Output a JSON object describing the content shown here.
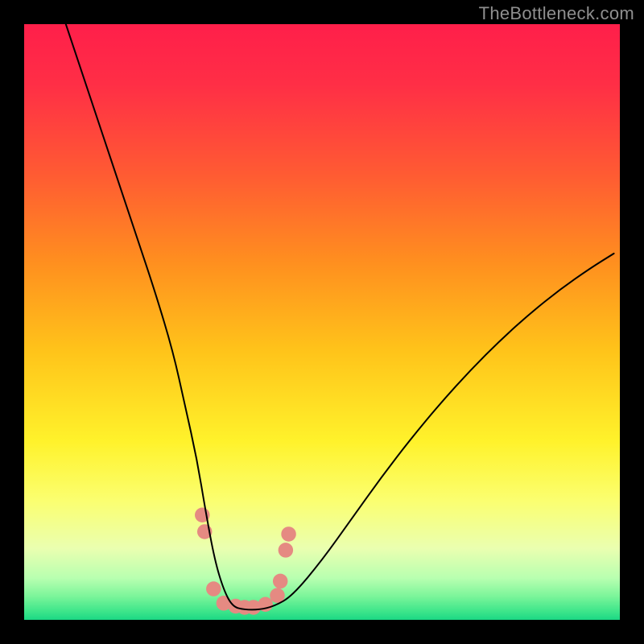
{
  "watermark": {
    "text": "TheBottleneck.com"
  },
  "plot": {
    "background_gradient_stops": [
      {
        "offset": 0.0,
        "color": "#ff1f4a"
      },
      {
        "offset": 0.1,
        "color": "#ff2e46"
      },
      {
        "offset": 0.25,
        "color": "#ff5a33"
      },
      {
        "offset": 0.4,
        "color": "#ff8f1f"
      },
      {
        "offset": 0.55,
        "color": "#ffc41a"
      },
      {
        "offset": 0.7,
        "color": "#fff22b"
      },
      {
        "offset": 0.8,
        "color": "#fbff70"
      },
      {
        "offset": 0.88,
        "color": "#eaffb0"
      },
      {
        "offset": 0.93,
        "color": "#b8ffb0"
      },
      {
        "offset": 0.96,
        "color": "#7cf59a"
      },
      {
        "offset": 0.985,
        "color": "#3fe68b"
      },
      {
        "offset": 1.0,
        "color": "#1bd884"
      }
    ]
  },
  "chart_data": {
    "type": "line",
    "title": "",
    "xlabel": "",
    "ylabel": "",
    "xlim": [
      0,
      100
    ],
    "ylim": [
      0,
      100
    ],
    "legend": false,
    "grid": false,
    "series": [
      {
        "name": "bottleneck-curve",
        "color": "#000000",
        "x": [
          7,
          10,
          13,
          16,
          19,
          22,
          25,
          27,
          29,
          30.5,
          32,
          33.5,
          35,
          37,
          39.5,
          42,
          45,
          50,
          55,
          60,
          65,
          70,
          75,
          80,
          85,
          90,
          95,
          99
        ],
        "y": [
          100,
          91,
          82,
          73,
          64,
          55,
          45,
          36,
          27,
          18,
          10,
          5,
          2.2,
          1.7,
          1.7,
          2.3,
          4,
          10,
          17,
          24,
          30.5,
          36.5,
          42,
          47,
          51.5,
          55.5,
          59,
          61.5
        ]
      },
      {
        "name": "bottom-markers",
        "type": "scatter",
        "color": "#e58a82",
        "x": [
          29.9,
          30.3,
          31.8,
          33.5,
          35.5,
          37.0,
          38.5,
          40.5,
          42.5,
          43.0,
          43.9,
          44.4
        ],
        "y": [
          17.6,
          14.8,
          5.2,
          2.8,
          2.3,
          2.1,
          2.1,
          2.6,
          4.1,
          6.5,
          11.7,
          14.4
        ]
      }
    ],
    "annotations": [
      {
        "text": "TheBottleneck.com",
        "x": 92,
        "y": 100,
        "role": "watermark"
      }
    ]
  }
}
